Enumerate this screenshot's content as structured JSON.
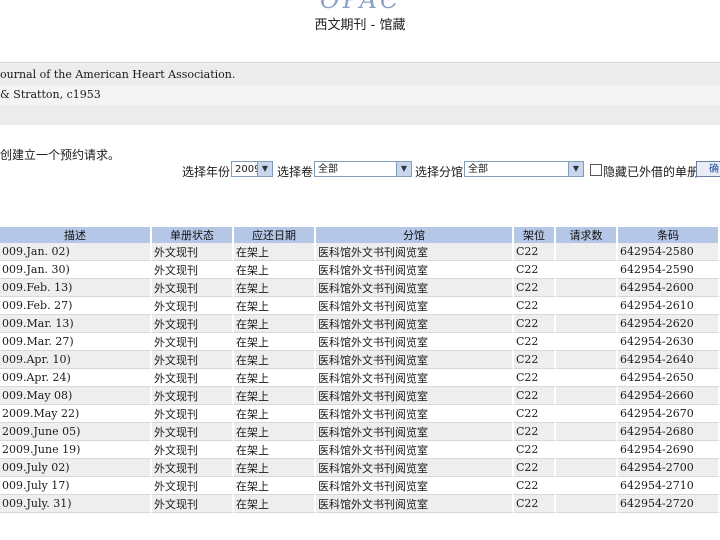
{
  "header": {
    "logo_fragment": "OPAC",
    "title": "西文期刊 - 馆藏"
  },
  "record": {
    "title_line": "ournal of the American Heart Association.",
    "publisher_line": "& Stratton, c1953"
  },
  "notice": "创建立一个预约请求。",
  "filters": {
    "year_label": "选择年份",
    "year_value": "2009",
    "volume_label": "选择卷",
    "volume_value": "全部",
    "branch_label": "选择分馆",
    "branch_value": "全部",
    "hide_checked_out_label": "隐藏已外借的单册",
    "go_label": "确"
  },
  "table": {
    "headers": [
      "描述",
      "单册状态",
      "应还日期",
      "分馆",
      "架位",
      "请求数",
      "条码"
    ],
    "rows": [
      {
        "desc": "009.Jan. 02)",
        "status": "外文现刊",
        "due": "在架上",
        "loc": "医科馆外文书刊阅览室",
        "shelf": "C22",
        "requests": "",
        "barcode": "642954-2580"
      },
      {
        "desc": "009.Jan. 30)",
        "status": "外文现刊",
        "due": "在架上",
        "loc": "医科馆外文书刊阅览室",
        "shelf": "C22",
        "requests": "",
        "barcode": "642954-2590"
      },
      {
        "desc": "009.Feb. 13)",
        "status": "外文现刊",
        "due": "在架上",
        "loc": "医科馆外文书刊阅览室",
        "shelf": "C22",
        "requests": "",
        "barcode": "642954-2600"
      },
      {
        "desc": "009.Feb. 27)",
        "status": "外文现刊",
        "due": "在架上",
        "loc": "医科馆外文书刊阅览室",
        "shelf": "C22",
        "requests": "",
        "barcode": "642954-2610"
      },
      {
        "desc": "009.Mar. 13)",
        "status": "外文现刊",
        "due": "在架上",
        "loc": "医科馆外文书刊阅览室",
        "shelf": "C22",
        "requests": "",
        "barcode": "642954-2620"
      },
      {
        "desc": "009.Mar. 27)",
        "status": "外文现刊",
        "due": "在架上",
        "loc": "医科馆外文书刊阅览室",
        "shelf": "C22",
        "requests": "",
        "barcode": "642954-2630"
      },
      {
        "desc": "009.Apr. 10)",
        "status": "外文现刊",
        "due": "在架上",
        "loc": "医科馆外文书刊阅览室",
        "shelf": "C22",
        "requests": "",
        "barcode": "642954-2640"
      },
      {
        "desc": "009.Apr. 24)",
        "status": "外文现刊",
        "due": "在架上",
        "loc": "医科馆外文书刊阅览室",
        "shelf": "C22",
        "requests": "",
        "barcode": "642954-2650"
      },
      {
        "desc": "009.May 08)",
        "status": "外文现刊",
        "due": "在架上",
        "loc": "医科馆外文书刊阅览室",
        "shelf": "C22",
        "requests": "",
        "barcode": "642954-2660"
      },
      {
        "desc": "2009.May 22)",
        "status": "外文现刊",
        "due": "在架上",
        "loc": "医科馆外文书刊阅览室",
        "shelf": "C22",
        "requests": "",
        "barcode": "642954-2670"
      },
      {
        "desc": "2009.June 05)",
        "status": "外文现刊",
        "due": "在架上",
        "loc": "医科馆外文书刊阅览室",
        "shelf": "C22",
        "requests": "",
        "barcode": "642954-2680"
      },
      {
        "desc": "2009.June 19)",
        "status": "外文现刊",
        "due": "在架上",
        "loc": "医科馆外文书刊阅览室",
        "shelf": "C22",
        "requests": "",
        "barcode": "642954-2690"
      },
      {
        "desc": "009.July 02)",
        "status": "外文现刊",
        "due": "在架上",
        "loc": "医科馆外文书刊阅览室",
        "shelf": "C22",
        "requests": "",
        "barcode": "642954-2700"
      },
      {
        "desc": "009.July 17)",
        "status": "外文现刊",
        "due": "在架上",
        "loc": "医科馆外文书刊阅览室",
        "shelf": "C22",
        "requests": "",
        "barcode": "642954-2710"
      },
      {
        "desc": "009.July. 31)",
        "status": "外文现刊",
        "due": "在架上",
        "loc": "医科馆外文书刊阅览室",
        "shelf": "C22",
        "requests": "",
        "barcode": "642954-2720"
      }
    ]
  },
  "colors": {
    "header_bg": "#b5c7e6",
    "row_alt": "#eeeeee",
    "info_bg": "#f0f0f0",
    "select_border": "#7f9db9"
  }
}
